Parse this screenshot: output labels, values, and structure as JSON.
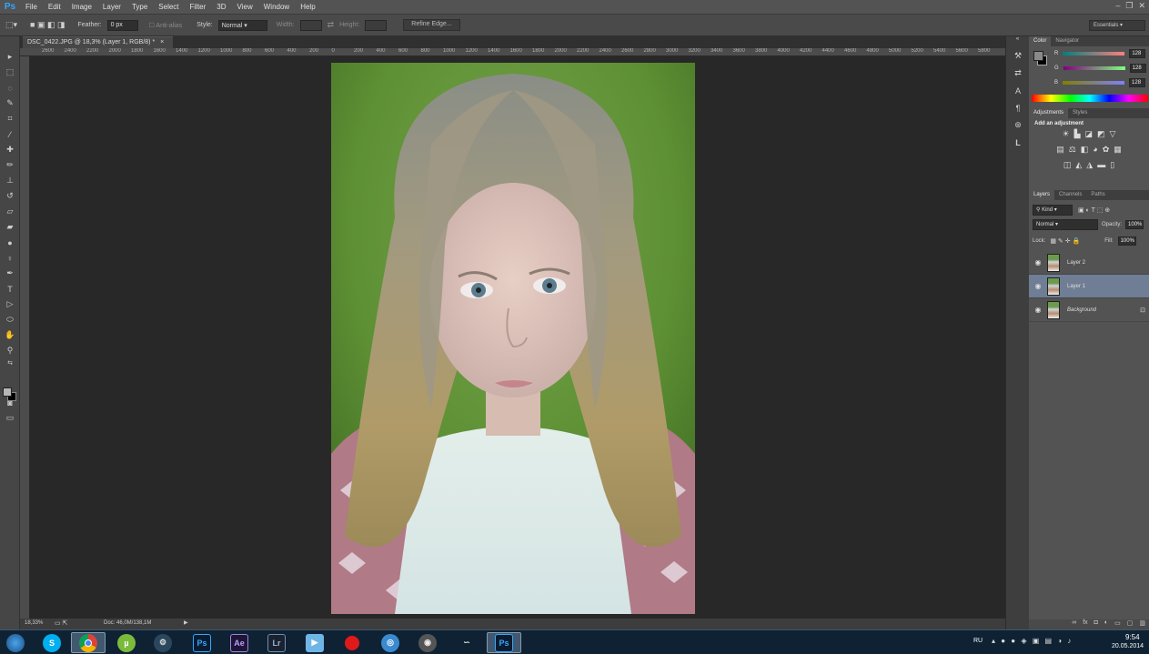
{
  "app": {
    "logo": "Ps"
  },
  "menu": [
    "File",
    "Edit",
    "Image",
    "Layer",
    "Type",
    "Select",
    "Filter",
    "3D",
    "View",
    "Window",
    "Help"
  ],
  "window_controls": [
    "–",
    "❐",
    "✕"
  ],
  "options": {
    "feather_label": "Feather:",
    "feather_value": "0 px",
    "antialias_label": "Anti-alias",
    "style_label": "Style:",
    "style_value": "Normal",
    "width_label": "Width:",
    "height_label": "Height:",
    "refine_edge": "Refine Edge...",
    "workspace": "Essentials"
  },
  "document": {
    "tab_title": "DSC_0422.JPG @ 18,3% (Layer 1, RGB/8) *",
    "close": "×"
  },
  "ruler": {
    "labels": [
      "2600",
      "2400",
      "2200",
      "2000",
      "1800",
      "1600",
      "1400",
      "1200",
      "1000",
      "800",
      "600",
      "400",
      "200",
      "0",
      "200",
      "400",
      "600",
      "800",
      "1000",
      "1200",
      "1400",
      "1600",
      "1800",
      "2000",
      "2200",
      "2400",
      "2600",
      "2800",
      "3000",
      "3200",
      "3400",
      "3600",
      "3800",
      "4000",
      "4200",
      "4400",
      "4600",
      "4800",
      "5000",
      "5200",
      "5400",
      "5600",
      "5800"
    ]
  },
  "status": {
    "zoom": "18,33%",
    "doc": "Doc: 46,0M/138,1M",
    "arrow": "▶"
  },
  "color_panel": {
    "tabs": [
      "Color",
      "Navigator"
    ],
    "channels": [
      {
        "label": "R",
        "value": "128"
      },
      {
        "label": "G",
        "value": "128"
      },
      {
        "label": "B",
        "value": "128"
      }
    ]
  },
  "adjustments_panel": {
    "tabs": [
      "Adjustments",
      "Styles"
    ],
    "heading": "Add an adjustment"
  },
  "layers_panel": {
    "tabs": [
      "Layers",
      "Channels",
      "Paths"
    ],
    "kind": "Kind",
    "blend_mode": "Normal",
    "opacity_label": "Opacity:",
    "opacity_value": "100%",
    "lock_label": "Lock:",
    "fill_label": "Fill:",
    "fill_value": "100%",
    "layers": [
      {
        "name": "Layer 2",
        "selected": false,
        "locked": false
      },
      {
        "name": "Layer 1",
        "selected": true,
        "locked": false
      },
      {
        "name": "Background",
        "selected": false,
        "locked": true
      }
    ],
    "footer_icons": [
      "link-icon",
      "fx-icon",
      "mask-icon",
      "adjustment-icon",
      "folder-icon",
      "new-layer-icon",
      "trash-icon"
    ]
  },
  "taskbar": {
    "apps": [
      {
        "name": "start",
        "label": ""
      },
      {
        "name": "skype",
        "label": "S"
      },
      {
        "name": "chrome",
        "label": ""
      },
      {
        "name": "utorrent",
        "label": "µ"
      },
      {
        "name": "steam",
        "label": ""
      },
      {
        "name": "photoshop",
        "label": "Ps"
      },
      {
        "name": "after-effects",
        "label": "Ae"
      },
      {
        "name": "lightroom",
        "label": "Lr"
      },
      {
        "name": "media-player",
        "label": "▶"
      },
      {
        "name": "recorder",
        "label": ""
      },
      {
        "name": "app-11",
        "label": ""
      },
      {
        "name": "app-12",
        "label": ""
      },
      {
        "name": "app-13",
        "label": ""
      },
      {
        "name": "photoshop-active",
        "label": "Ps"
      }
    ],
    "lang": "RU",
    "time": "9:54",
    "date": "20.05.2014"
  }
}
